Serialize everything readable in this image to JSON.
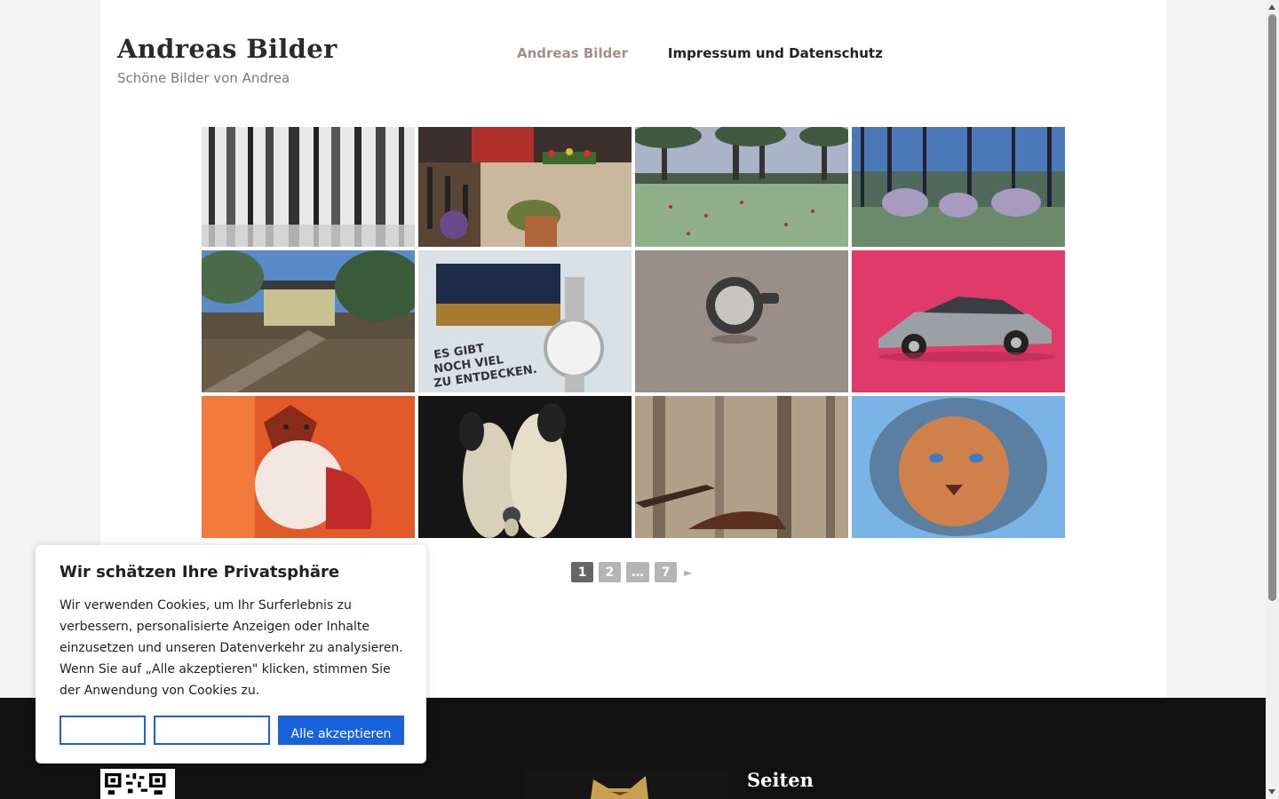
{
  "site": {
    "title": "Andreas Bilder",
    "description": "Schöne Bilder von Andrea"
  },
  "nav": {
    "items": [
      {
        "label": "Andreas Bilder",
        "active": true
      },
      {
        "label": "Impressum und Datenschutz",
        "active": false
      }
    ]
  },
  "gallery": {
    "images": [
      {
        "name": "birch-forest-painting-icon"
      },
      {
        "name": "flowerpot-stairs-painting-icon"
      },
      {
        "name": "poppy-meadow-painting-icon"
      },
      {
        "name": "wild-boars-forest-painting-icon"
      },
      {
        "name": "garden-house-painting-icon"
      },
      {
        "name": "watch-collage-painting-icon",
        "caption": "ES GIBT NOCH VIEL ZU ENTDECKEN."
      },
      {
        "name": "cup-painting-icon"
      },
      {
        "name": "delorean-car-painting-icon"
      },
      {
        "name": "fox-painting-icon"
      },
      {
        "name": "penguins-painting-icon"
      },
      {
        "name": "fox-forest-painting-icon"
      },
      {
        "name": "lion-drawing-icon"
      }
    ]
  },
  "pagination": {
    "pages": [
      "1",
      "2",
      "…",
      "7"
    ],
    "current": "1",
    "next_symbol": "►"
  },
  "cookie": {
    "title": "Wir schätzen Ihre Privatsphäre",
    "text": "Wir verwenden Cookies, um Ihr Surferlebnis zu verbessern, personalisierte Anzeigen oder Inhalte einzusetzen und unseren Datenverkehr zu analysieren. Wenn Sie auf „Alle akzeptieren\" klicken, stimmen Sie der Anwendung von Cookies zu.",
    "button1_label": "",
    "button2_label": "",
    "accept_label": "Alle akzeptieren",
    "accent_color": "#1863dc"
  },
  "footer": {
    "heading": "Seiten"
  }
}
